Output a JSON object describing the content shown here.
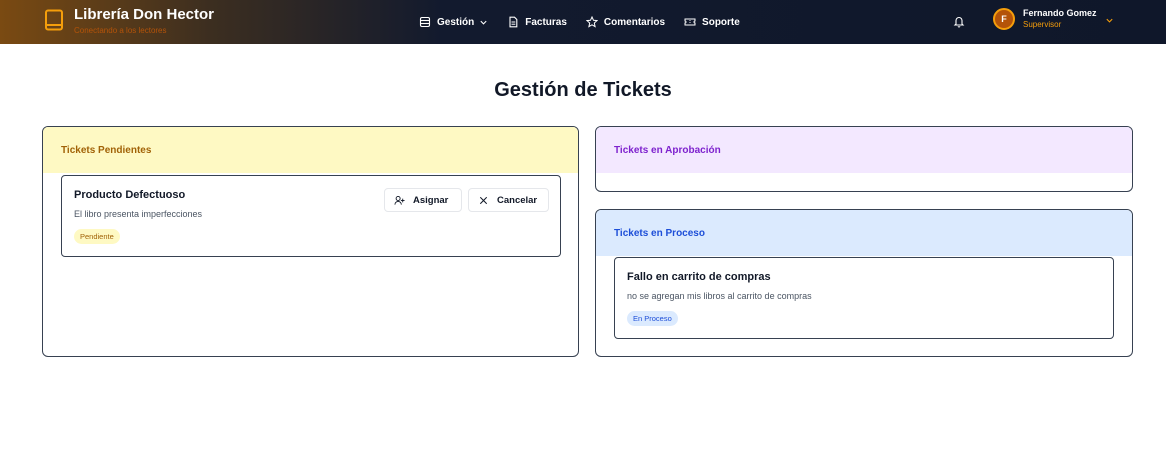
{
  "brand": {
    "title": "Librería Don Hector",
    "tagline": "Conectando a los lectores"
  },
  "nav": {
    "gestion": "Gestión",
    "facturas": "Facturas",
    "comentarios": "Comentarios",
    "soporte": "Soporte"
  },
  "user": {
    "initial": "F",
    "name": "Fernando Gomez",
    "role": "Supervisor"
  },
  "page": {
    "title": "Gestión de Tickets"
  },
  "panels": {
    "pendientes": {
      "title": "Tickets Pendientes",
      "tickets": [
        {
          "title": "Producto Defectuoso",
          "description": "El libro presenta imperfecciones",
          "status": "Pendiente"
        }
      ],
      "actions": {
        "assign": "Asignar",
        "cancel": "Cancelar"
      }
    },
    "aprobacion": {
      "title": "Tickets en Aprobación"
    },
    "proceso": {
      "title": "Tickets en Proceso",
      "tickets": [
        {
          "title": "Fallo en carrito de compras",
          "description": "no se agregan mis libros al carrito de compras",
          "status": "En Proceso"
        }
      ]
    }
  },
  "colors": {
    "pending_bg": "#fef9c3",
    "pending_text": "#a16207",
    "approval_bg": "#f3e8ff",
    "approval_text": "#7e22ce",
    "process_bg": "#dbeafe",
    "process_text": "#1d4ed8",
    "accent": "#f59e0b"
  },
  "icons": [
    "book-icon",
    "database-icon",
    "file-text-icon",
    "star-icon",
    "ticket-icon",
    "bell-icon",
    "chevron-down-icon",
    "user-plus-icon",
    "x-icon"
  ]
}
